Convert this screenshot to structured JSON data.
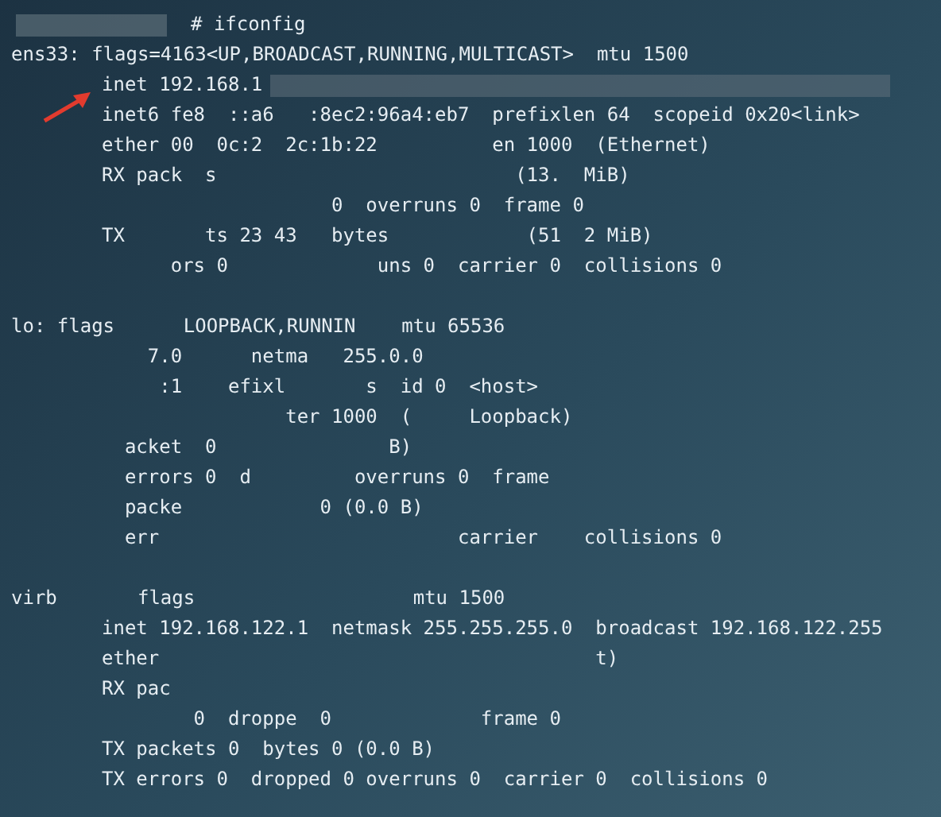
{
  "terminal": {
    "lines": [
      {
        "kind": "prompt",
        "indent": false,
        "text": "# ifconfig"
      },
      {
        "indent": false,
        "text": "ens33: flags=4163<UP,BROADCAST,RUNNING,MULTICAST>  mtu 1500"
      },
      {
        "indent": true,
        "text": "inet 192.168.1"
      },
      {
        "indent": true,
        "text": "inet6 fe8  ::a6   :8ec2:96a4:eb7  prefixlen 64  scopeid 0x20<link>"
      },
      {
        "indent": true,
        "text": "ether 00  0c:2  2c:1b:22          en 1000  (Ethernet)"
      },
      {
        "indent": true,
        "text": "RX pack  s                          (13.  MiB)"
      },
      {
        "indent": true,
        "text": "                    0  overruns 0  frame 0"
      },
      {
        "indent": true,
        "text": "TX       ts 23 43   bytes            (51  2 MiB)"
      },
      {
        "indent": true,
        "text": "      ors 0             uns 0  carrier 0  collisions 0"
      },
      {
        "kind": "blank"
      },
      {
        "indent": false,
        "text": "lo: flags      LOOPBACK,RUNNIN    mtu 65536"
      },
      {
        "indent": true,
        "text": "    7.0      netma   255.0.0"
      },
      {
        "indent": true,
        "text": "     :1    efixl       s  id 0  <host>"
      },
      {
        "indent": true,
        "text": "                ter 1000  (     Loopback)"
      },
      {
        "indent": true,
        "text": "  acket  0               B)"
      },
      {
        "indent": true,
        "text": "  errors 0  d         overruns 0  frame"
      },
      {
        "indent": true,
        "text": "  packe            0 (0.0 B)"
      },
      {
        "indent": true,
        "text": "  err                          carrier    collisions 0"
      },
      {
        "kind": "blank"
      },
      {
        "indent": false,
        "text": "virb       flags                   mtu 1500"
      },
      {
        "indent": true,
        "text": "inet 192.168.122.1  netmask 255.255.255.0  broadcast 192.168.122.255"
      },
      {
        "indent": true,
        "text": "ether                                      t)"
      },
      {
        "indent": true,
        "text": "RX pac"
      },
      {
        "indent": true,
        "text": "        0  droppe  0             frame 0"
      },
      {
        "indent": true,
        "text": "TX packets 0  bytes 0 (0.0 B)"
      },
      {
        "indent": true,
        "text": "TX errors 0  dropped 0 overruns 0  carrier 0  collisions 0"
      }
    ]
  }
}
